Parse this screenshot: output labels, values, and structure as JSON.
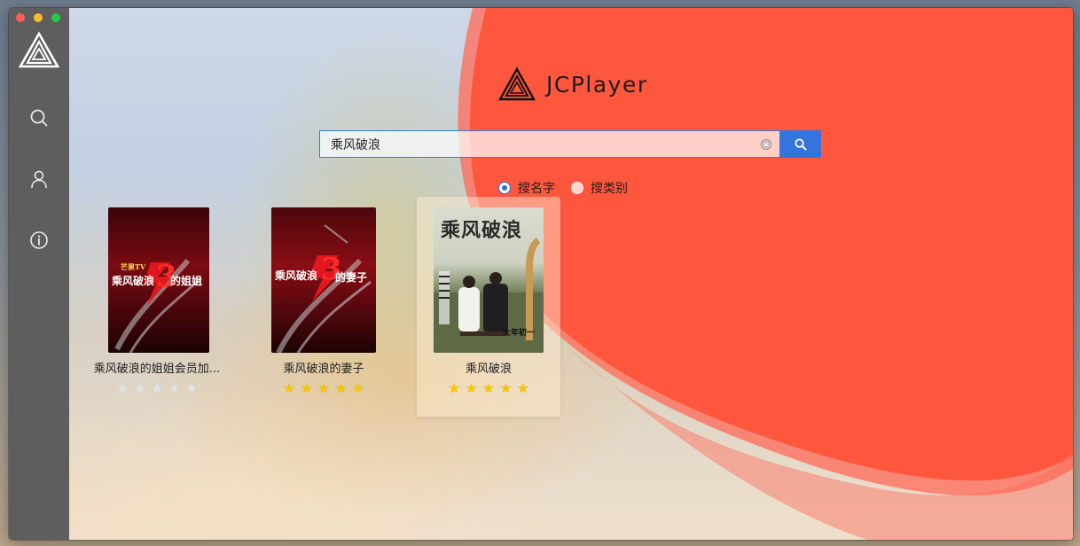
{
  "app": {
    "title": "JCPlayer"
  },
  "search": {
    "value": "乘风破浪",
    "placeholder": ""
  },
  "search_modes": [
    {
      "label": "搜名字",
      "selected": true
    },
    {
      "label": "搜类别",
      "selected": false
    }
  ],
  "results": [
    {
      "title": "乘风破浪的姐姐会员加...",
      "rating": 0,
      "poster": {
        "badge": "芒果TV",
        "line1": "乘风破浪",
        "line2": "的姐姐",
        "num": "3"
      }
    },
    {
      "title": "乘风破浪的妻子",
      "rating": 5,
      "poster": {
        "line1": "乘风破浪",
        "line2": "的妻子",
        "num": "3"
      }
    },
    {
      "title": "乘风破浪",
      "rating": 5,
      "poster": {
        "calligraphy": "乘风破浪",
        "footer": "大年初一"
      }
    }
  ],
  "colors": {
    "accent": "#3574dd",
    "sidebar": "#5e5e5e",
    "blob": "#ff533b",
    "star_on": "#f7c600",
    "star_off": "#e4e4e4"
  },
  "icons": [
    "app-logo-icon",
    "search-icon",
    "user-icon",
    "info-icon",
    "clear-icon",
    "search-button-icon",
    "star-icon"
  ]
}
